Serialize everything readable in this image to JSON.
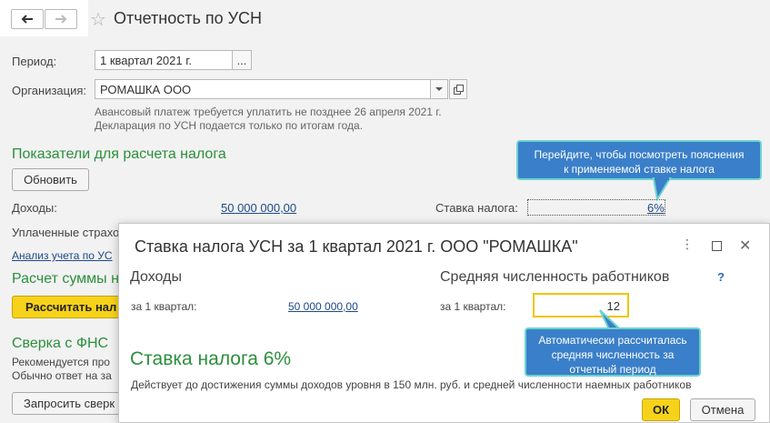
{
  "header": {
    "title": "Отчетность по УСН"
  },
  "form": {
    "period_label": "Период:",
    "period_value": "1 квартал 2021 г.",
    "period_btn": "...",
    "org_label": "Организация:",
    "org_value": "РОМАШКА ООО",
    "note1": "Авансовый платеж требуется уплатить не позднее 26 апреля 2021 г.",
    "note2": "Декларация по УСН подается только по итогам года.",
    "section1": "Показатели для расчета налога",
    "refresh_button": "Обновить",
    "income_label": "Доходы:",
    "income_value": "50 000 000,00",
    "rate_label": "Ставка налога:",
    "rate_value": "6%",
    "paid_label": "Уплаченные страхо",
    "analysis_link": "Анализ учета по УС",
    "section2": "Расчет суммы н",
    "calc_button": "Рассчитать нал",
    "section3": "Сверка с ФНС",
    "recon_text1": "Рекомендуется про",
    "recon_text2": "Обычно ответ на за",
    "request_button": "Запросить сверк"
  },
  "tooltip1": {
    "line1": "Перейдите, чтобы посмотреть пояснения",
    "line2": "к применяемой ставке налога"
  },
  "tooltip2": {
    "line1": "Автоматически рассчиталась",
    "line2": "средняя численность за",
    "line3": "отчетный период"
  },
  "dialog": {
    "title": "Ставка налога УСН за 1 квартал 2021 г. ООО \"РОМАШКА\"",
    "income_heading": "Доходы",
    "income_period_label": "за 1 квартал:",
    "income_value": "50 000 000,00",
    "staff_heading": "Средняя численность работников",
    "help": "?",
    "staff_period_label": "за 1 квартал:",
    "staff_value": "12",
    "rate_heading": "Ставка налога 6%",
    "rate_note": "Действует до достижения суммы доходов уровня в 150 млн. руб. и средней численности наемных работников",
    "ok_button": "ОК",
    "cancel_button": "Отмена"
  }
}
